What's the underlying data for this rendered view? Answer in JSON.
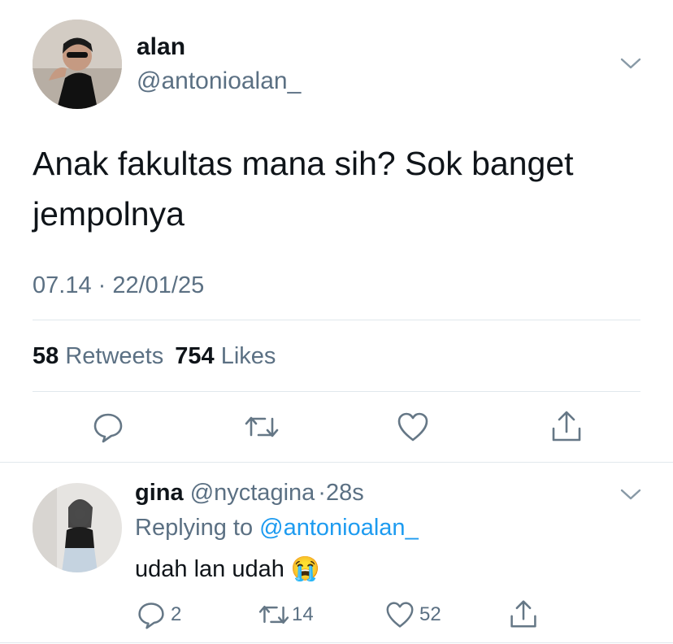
{
  "tweet": {
    "display_name": "alan",
    "handle": "@antonioalan_",
    "text_line1": "Anak fakultas mana sih? Sok banget",
    "text_line2": "jempolnya",
    "timestamp": "07.14 · 22/01/25",
    "retweets_count": "58",
    "retweets_label": "Retweets",
    "likes_count": "754",
    "likes_label": "Likes"
  },
  "reply": {
    "display_name": "gina",
    "handle": "@nyctagina",
    "separator": "·",
    "time_ago": "28s",
    "replying_to_label": "Replying to",
    "replying_to_handle": "@antonioalan_",
    "text": "udah lan udah",
    "emoji": "😭",
    "reply_count": "2",
    "retweet_count": "14",
    "like_count": "52"
  },
  "icons": {
    "menu": "chevron-down-icon",
    "reply": "comment-icon",
    "retweet": "retweet-icon",
    "like": "heart-icon",
    "share": "share-icon"
  },
  "colors": {
    "text": "#0f1419",
    "muted": "#5b7083",
    "link": "#1d9bf0",
    "divider": "#e1e8ed"
  }
}
